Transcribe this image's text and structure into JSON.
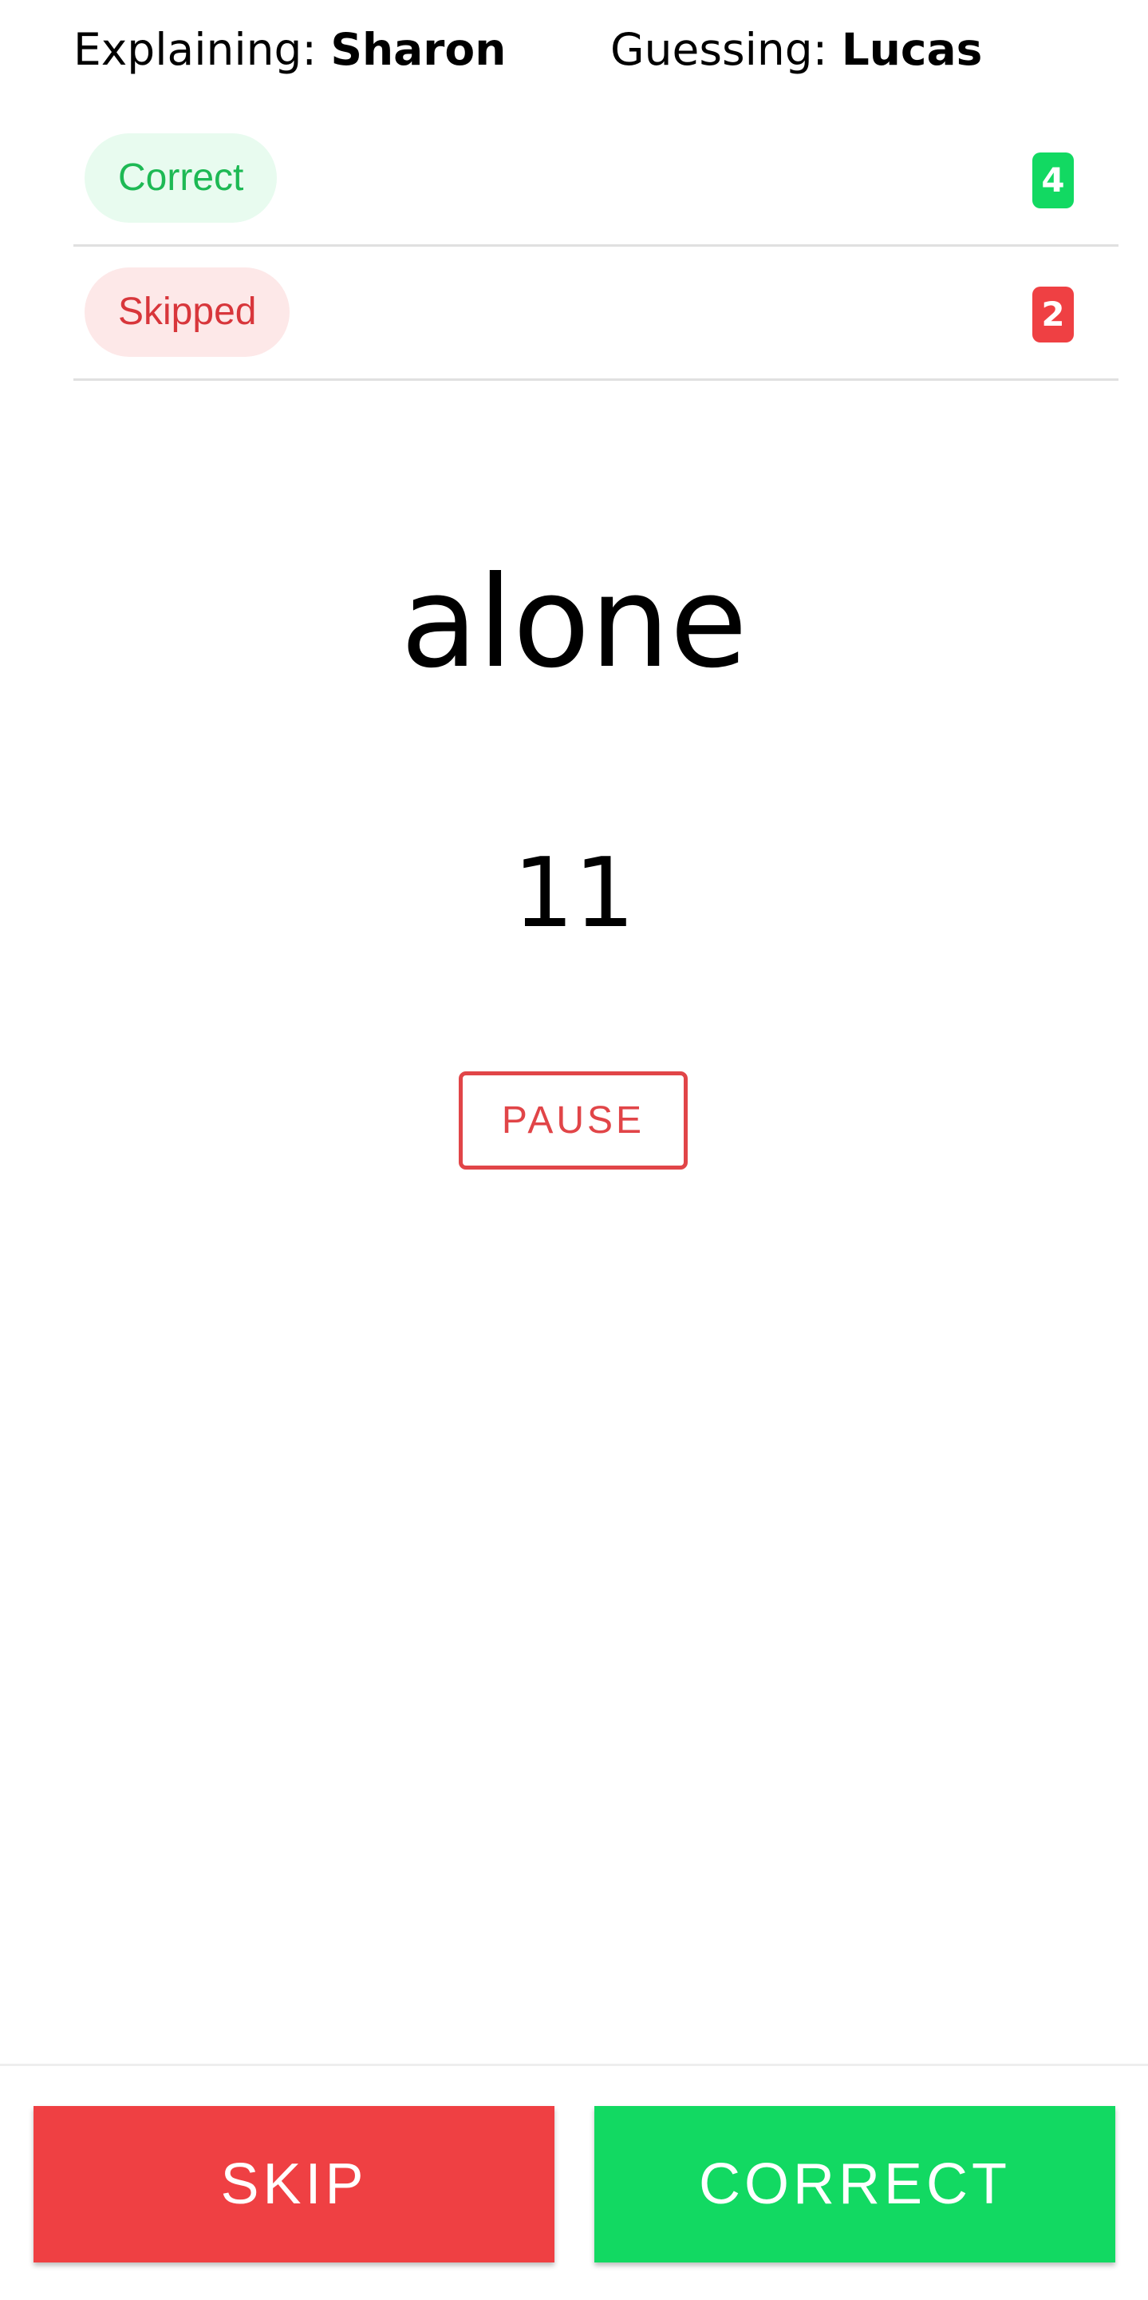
{
  "players": {
    "explaining_label": "Explaining:",
    "explaining_name": "Sharon",
    "guessing_label": "Guessing:",
    "guessing_name": "Lucas"
  },
  "score": {
    "correct": {
      "label": "Correct",
      "count": "4",
      "color": "#12d962"
    },
    "skipped": {
      "label": "Skipped",
      "count": "2",
      "color": "#ef4043"
    }
  },
  "round": {
    "word": "alone",
    "timer": "11",
    "pause_label": "PAUSE"
  },
  "actions": {
    "skip_label": "SKIP",
    "correct_label": "CORRECT"
  }
}
